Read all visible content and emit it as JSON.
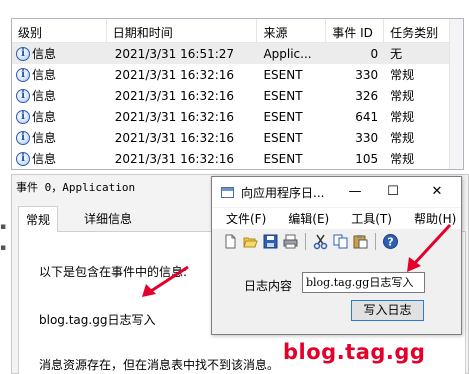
{
  "event_list": {
    "columns": [
      "级别",
      "日期和时间",
      "来源",
      "事件 ID",
      "任务类别"
    ],
    "rows": [
      {
        "level": "信息",
        "datetime": "2021/3/31 16:51:27",
        "source": "Applic...",
        "event_id": "0",
        "category": "无"
      },
      {
        "level": "信息",
        "datetime": "2021/3/31 16:32:16",
        "source": "ESENT",
        "event_id": "330",
        "category": "常规"
      },
      {
        "level": "信息",
        "datetime": "2021/3/31 16:32:16",
        "source": "ESENT",
        "event_id": "326",
        "category": "常规"
      },
      {
        "level": "信息",
        "datetime": "2021/3/31 16:32:16",
        "source": "ESENT",
        "event_id": "641",
        "category": "常规"
      },
      {
        "level": "信息",
        "datetime": "2021/3/31 16:32:16",
        "source": "ESENT",
        "event_id": "330",
        "category": "常规"
      },
      {
        "level": "信息",
        "datetime": "2021/3/31 16:32:16",
        "source": "ESENT",
        "event_id": "105",
        "category": "常规"
      }
    ]
  },
  "details": {
    "title": "事件 0，Application",
    "tabs": [
      "常规",
      "详细信息"
    ],
    "lines": [
      "以下是包含在事件中的信息:",
      "blog.tag.gg日志写入",
      "消息资源存在，但在消息表中找不到该消息。"
    ]
  },
  "dialog": {
    "title": "向应用程序日...",
    "window_controls": {
      "minimize": "—",
      "maximize": "☐",
      "close": "✕"
    },
    "menu": [
      "文件(F)",
      "编辑(E)",
      "工具(T)",
      "帮助(H)"
    ],
    "toolbar_icons": [
      "new-file-icon",
      "open-folder-icon",
      "save-icon",
      "print-icon",
      "cut-icon",
      "copy-icon",
      "paste-icon",
      "help-icon"
    ],
    "field_label": "日志内容",
    "field_value": "blog.tag.gg日志写入",
    "button_label": "写入日志"
  },
  "watermark": "blog.tag.gg",
  "colors": {
    "accent_red": "#e4002b",
    "info_blue": "#2a5fb6",
    "button_border": "#2a7bd7"
  }
}
